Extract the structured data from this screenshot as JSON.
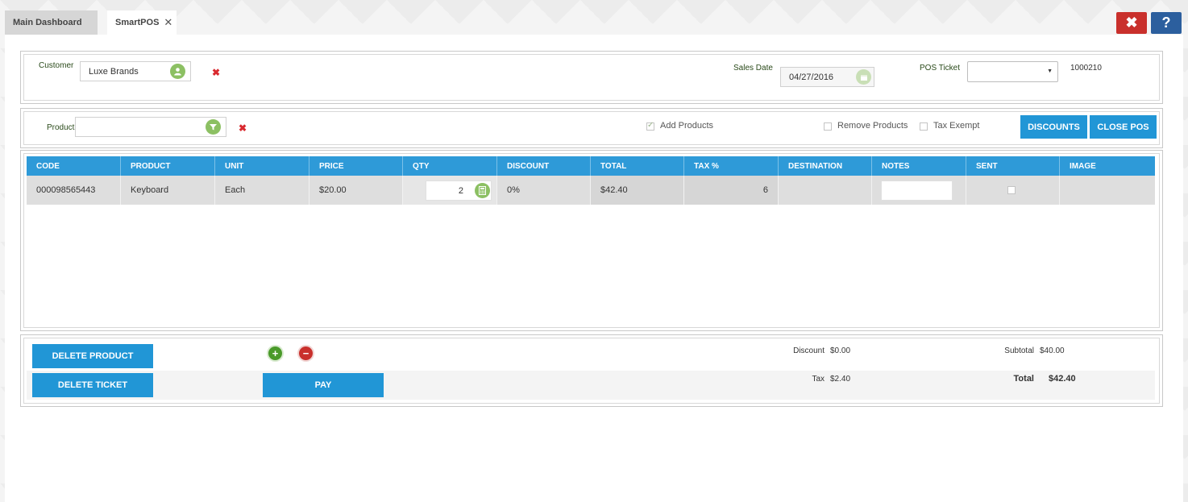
{
  "tabs": [
    {
      "label": "Main Dashboard"
    },
    {
      "label": "SmartPOS",
      "close": "✕"
    }
  ],
  "window": {
    "close": "✖",
    "help": "?"
  },
  "header": {
    "customer_label": "Customer",
    "customer_value": "Luxe Brands",
    "sales_date_label": "Sales Date",
    "sales_date_value": "04/27/2016",
    "pos_ticket_label": "POS Ticket",
    "pos_ticket_value": "",
    "ticket_number": "1000210"
  },
  "product_bar": {
    "product_label": "Product",
    "product_value": "",
    "add_products_label": "Add Products",
    "add_products_checked": true,
    "remove_products_label": "Remove Products",
    "tax_exempt_label": "Tax Exempt",
    "discounts_button": "DISCOUNTS",
    "close_pos_button": "CLOSE POS"
  },
  "table": {
    "columns": [
      "CODE",
      "PRODUCT",
      "UNIT",
      "PRICE",
      "QTY",
      "DISCOUNT",
      "TOTAL",
      "TAX %",
      "DESTINATION",
      "NOTES",
      "SENT",
      "IMAGE"
    ],
    "rows": [
      {
        "code": "000098565443",
        "product": "Keyboard",
        "unit": "Each",
        "price": "$20.00",
        "qty": "2",
        "discount": "0%",
        "total": "$42.40",
        "tax": "6",
        "destination": "",
        "notes": "",
        "sent": false
      }
    ]
  },
  "footer": {
    "delete_product": "DELETE PRODUCT",
    "delete_ticket": "DELETE TICKET",
    "pay": "PAY",
    "add_icon": "+",
    "remove_icon": "−",
    "discount_label": "Discount",
    "discount_value": "$0.00",
    "subtotal_label": "Subtotal",
    "subtotal_value": "$40.00",
    "tax_label": "Tax",
    "tax_value": "$2.40",
    "total_label": "Total",
    "total_value": "$42.40"
  },
  "colors": {
    "accent_blue": "#2196d6",
    "header_blue": "#2e9ad8",
    "danger_red": "#c9302c",
    "help_blue": "#2c5f9e",
    "icon_green": "#8cc063"
  }
}
